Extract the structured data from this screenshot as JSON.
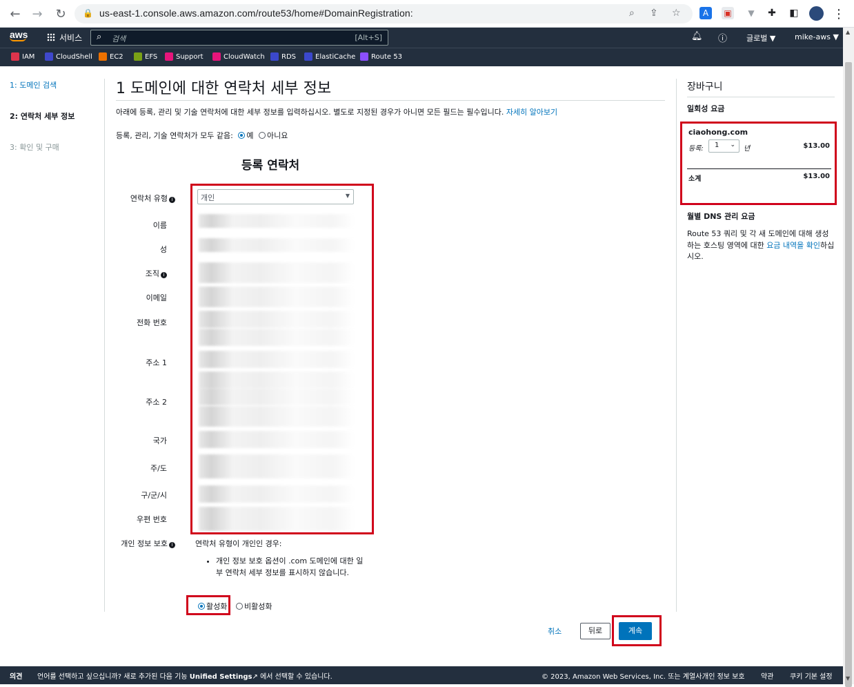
{
  "browser": {
    "url": "us-east-1.console.aws.amazon.com/route53/home#DomainRegistration:"
  },
  "aws_header": {
    "logo": "aws",
    "services": "서비스",
    "search_placeholder": "검색",
    "search_shortcut": "[Alt+S]",
    "region": "글로벌 ▼",
    "user": "mike-aws ▼"
  },
  "favorites": [
    "IAM",
    "CloudShell",
    "EC2",
    "EFS",
    "Support",
    "CloudWatch",
    "RDS",
    "ElastiCache",
    "Route 53"
  ],
  "favorite_colors": [
    "#dd344c",
    "#3f48cc",
    "#ed7100",
    "#7aa116",
    "#e7157b",
    "#e7157b",
    "#3b48cc",
    "#3b48cc",
    "#8c4fff"
  ],
  "steps": [
    "1: 도메인 검색",
    "2: 연락처 세부 정보",
    "3: 확인 및 구매"
  ],
  "main": {
    "title": "1 도메인에 대한 연락처 세부 정보",
    "desc": "아래에 등록, 관리 및 기술 연락처에 대한 세부 정보를 입력하십시오. 별도로 지정된 경우가 아니면 모든 필드는 필수입니다.",
    "learn_more": "자세히 알아보기",
    "same_contact": "등록, 관리, 기술 연락처가 모두 같음:",
    "yes": "예",
    "no": "아니요",
    "section_title": "등록 연락처",
    "contact_type_label": "연락처 유형",
    "contact_type_value": "개인",
    "fields": [
      "이름",
      "성",
      "조직",
      "이메일",
      "전화 번호",
      "주소 1",
      "주소 2",
      "국가",
      "주/도",
      "구/군/시",
      "우편 번호"
    ],
    "privacy_label": "개인 정보 보호",
    "privacy_desc": "연락처 유형이 개인인 경우:",
    "privacy_bullet": "개인 정보 보호 옵션이 .com 도메인에 대한 일부 연락처 세부 정보를 표시하지 않습니다.",
    "enable": "활성화",
    "disable": "비활성화",
    "cancel": "취소",
    "back": "뒤로",
    "continue": "계속"
  },
  "cart": {
    "title": "장바구니",
    "one_time": "일회성 요금",
    "domain": "ciaohong.com",
    "register_label": "등록:",
    "years": "1",
    "year_unit": "년",
    "price": "$13.00",
    "subtotal_label": "소계",
    "subtotal": "$13.00",
    "dns_title": "월별 DNS 관리 요금",
    "dns_desc_1": "Route 53 쿼리 및 각 새 도메인에 대해 생성하는 호스팅 영역에 대한 ",
    "dns_link": "요금 내역을 확인",
    "dns_desc_2": "하십시오."
  },
  "footer": {
    "feedback": "의견",
    "lang_text": "언어를 선택하고 싶으십니까? 새로 추가된 다음 기능",
    "unified": "Unified Settings",
    "lang_text_2": "에서 선택할 수 있습니다.",
    "copyright": "© 2023, Amazon Web Services, Inc. 또는 계열사.",
    "privacy": "개인 정보 보호",
    "terms": "약관",
    "cookies": "쿠키 기본 설정"
  }
}
